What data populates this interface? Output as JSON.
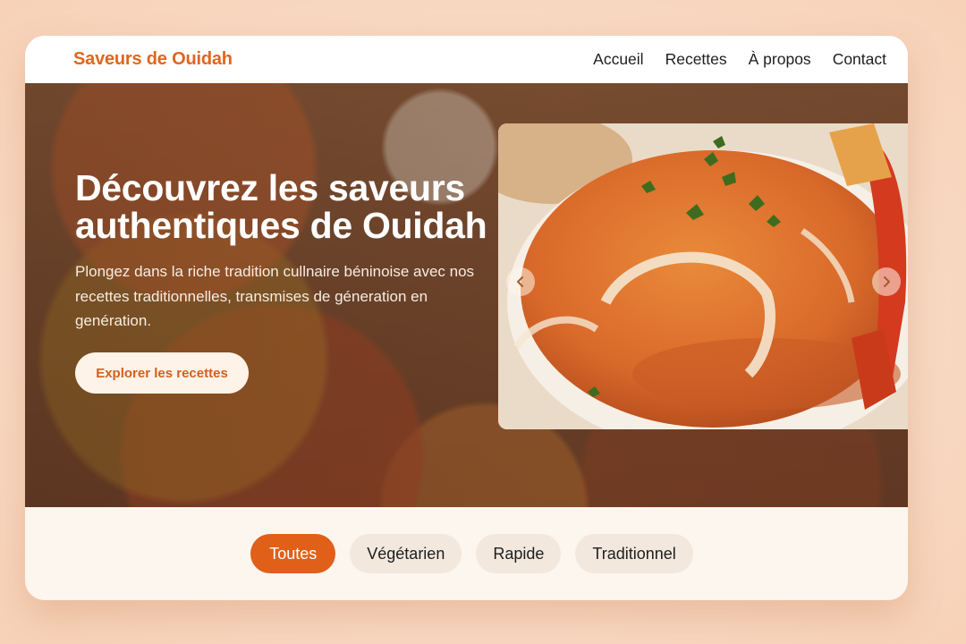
{
  "header": {
    "brand": "Saveurs de Ouidah",
    "nav": [
      "Accueil",
      "Recettes",
      "À propos",
      "Contact"
    ]
  },
  "hero": {
    "title_line1": "Découvrez les saveurs",
    "title_line2": "authentiques de Ouidah",
    "subtitle": "Plongez dans la riche tradition cullnaire béninoise avec nos recettes traditionnelles, transmises de géneration en genération.",
    "cta": "Explorer les recettes",
    "slider_prev_icon": "chevron-left-icon",
    "slider_next_icon": "chevron-right-icon"
  },
  "filters": {
    "chips": [
      "Toutes",
      "Végétarien",
      "Rapide",
      "Traditionnel"
    ],
    "active": "Toutes"
  },
  "colors": {
    "accent": "#e0601a",
    "brand": "#e0661e",
    "card_bg": "#fdf6ee",
    "chip_bg": "#f2e8de"
  }
}
